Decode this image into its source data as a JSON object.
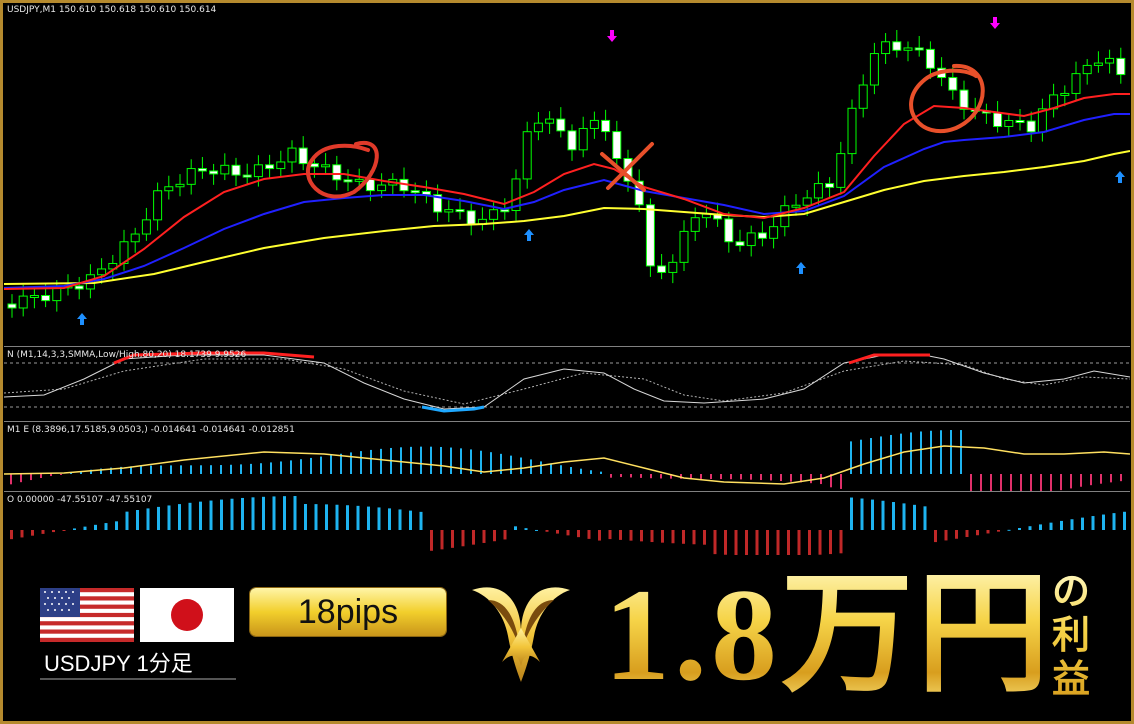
{
  "main_chart": {
    "header": "USDJPY,M1  150.610 150.618 150.610 150.614",
    "colors": {
      "fast_ma": "#ff2020",
      "mid_ma": "#1c1cff",
      "slow_ma": "#ffff30",
      "bull": "#00ff00",
      "bear_fill": "#ffffff",
      "buy_arrow": "#1e90ff",
      "sell_arrow": "#ff00ff",
      "mark": "#e8502a"
    }
  },
  "indicator_1": {
    "label": "N (M1,14,3,3,SMMA,Low/High,80,20) 18.1739 9.9526"
  },
  "indicator_2": {
    "label": "M1 E (8.3896,17.5185,9.0503,) -0.014641 -0.014641 -0.012851"
  },
  "indicator_3": {
    "label": "O 0.00000 -47.55107 -47.55107"
  },
  "banner": {
    "pair_label": "USDJPY  1分足",
    "pips": "18pips",
    "profit_amount": "1.8万円",
    "profit_suffix": "の利益",
    "flags": [
      "us-flag-icon",
      "japan-flag-icon"
    ],
    "accent": "#f2cf2c"
  }
}
